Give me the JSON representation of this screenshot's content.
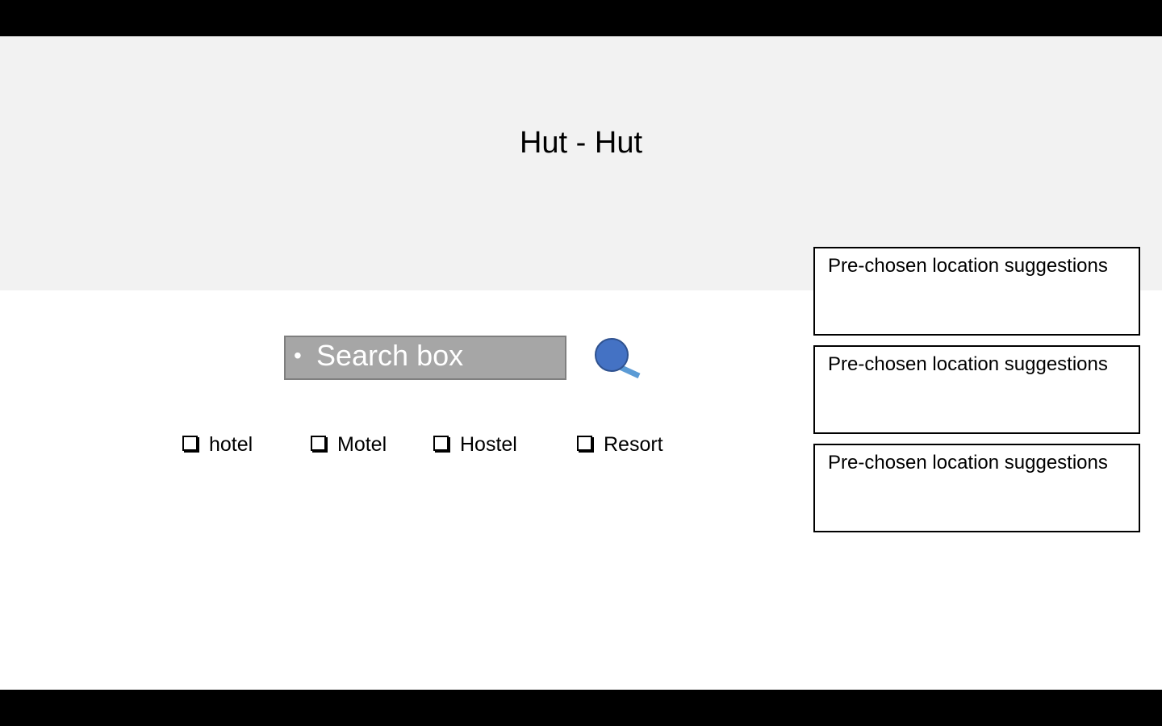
{
  "app": {
    "title": "Hut - Hut"
  },
  "search": {
    "bullet": "•",
    "placeholder": "Search box",
    "button_icon": "magnifier-icon"
  },
  "filters": [
    {
      "label": "hotel",
      "checked": false
    },
    {
      "label": "Motel",
      "checked": false
    },
    {
      "label": "Hostel",
      "checked": false
    },
    {
      "label": "Resort",
      "checked": false
    }
  ],
  "suggestions": [
    {
      "label": "Pre-chosen location suggestions"
    },
    {
      "label": "Pre-chosen location suggestions"
    },
    {
      "label": "Pre-chosen location suggestions"
    }
  ],
  "colors": {
    "header_band": "#f2f2f2",
    "search_box_fill": "#a6a6a6",
    "search_icon_fill": "#4472c4",
    "search_icon_handle": "#5b9bd5",
    "letterbox": "#000000"
  }
}
